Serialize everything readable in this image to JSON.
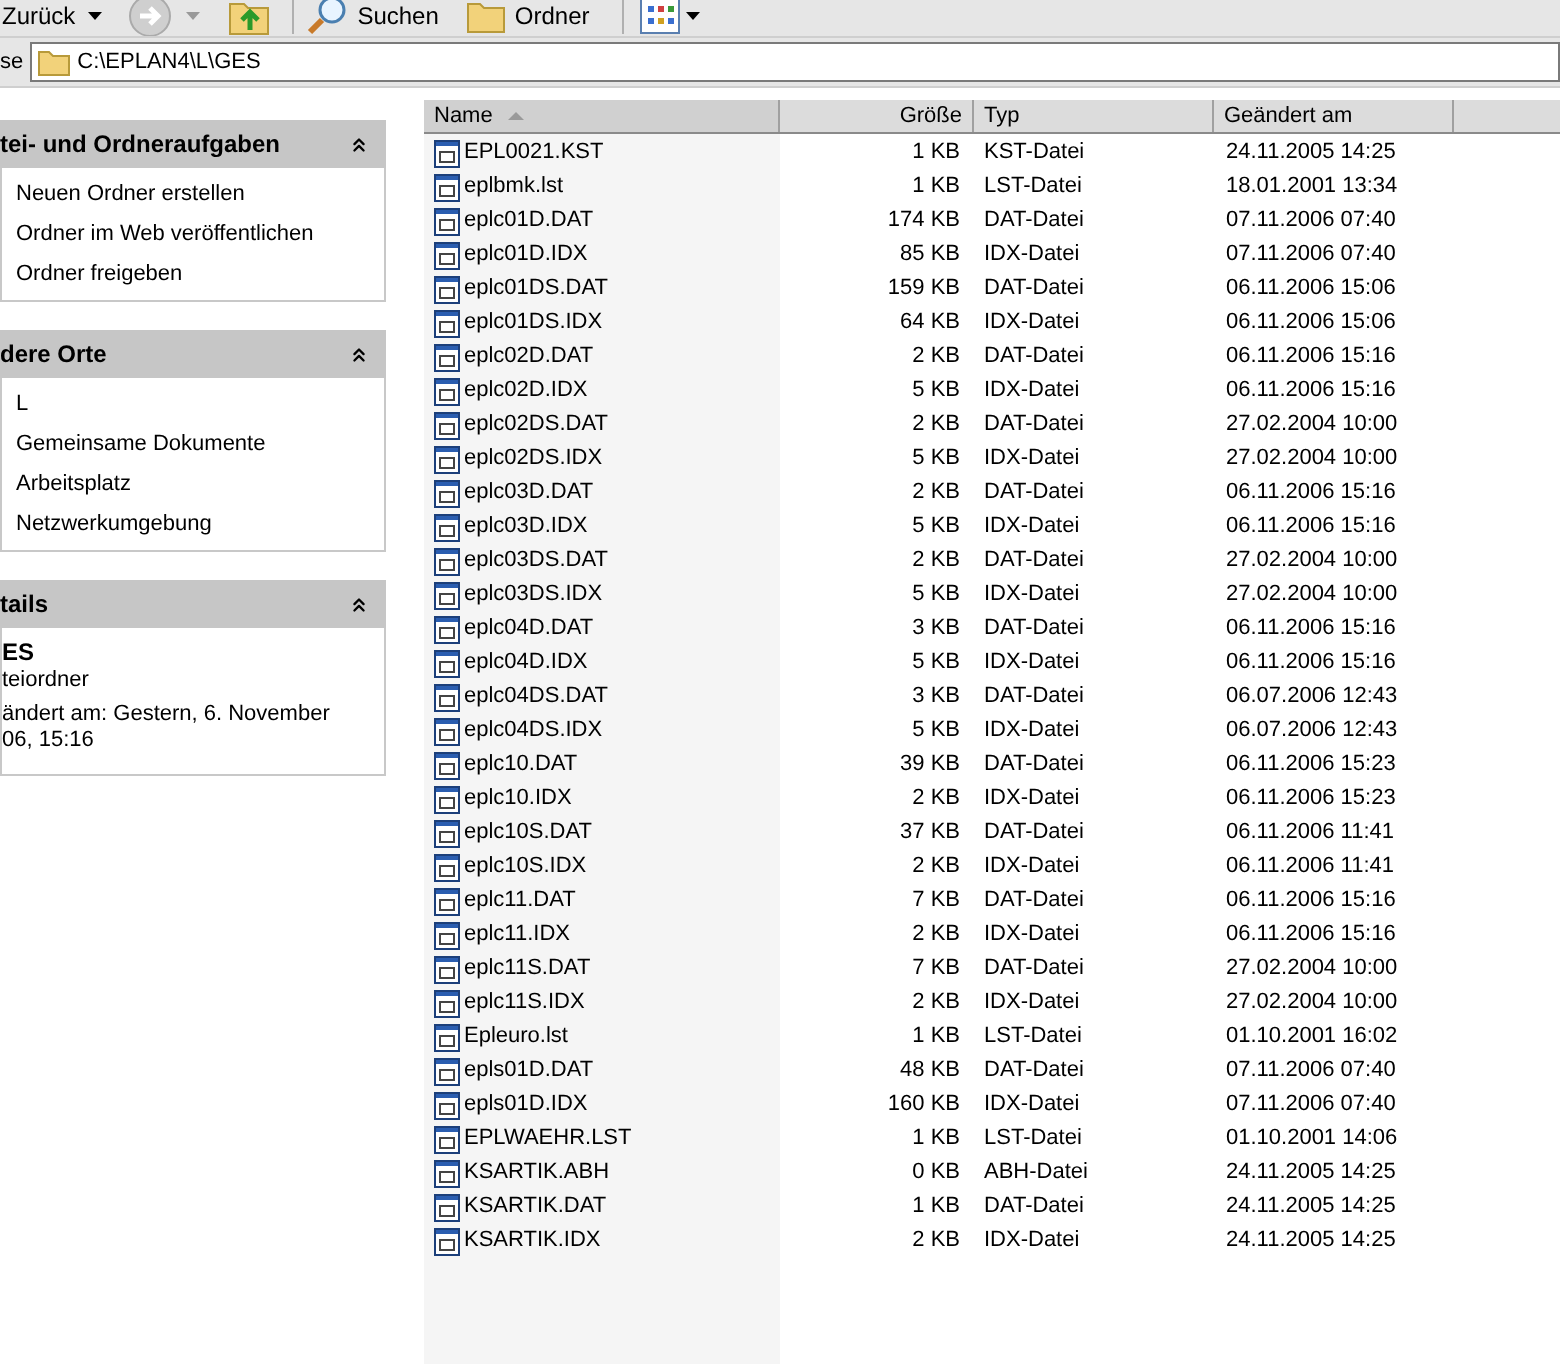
{
  "toolbar": {
    "back": "Zurück",
    "search": "Suchen",
    "folders": "Ordner"
  },
  "address": {
    "label": "se",
    "value": "C:\\EPLAN4\\L\\GES"
  },
  "sidebar": [
    {
      "kind": "links",
      "title": "tei- und Ordneraufgaben",
      "expanded": true,
      "items": [
        "Neuen Ordner erstellen",
        "Ordner im Web veröffentlichen",
        "Ordner freigeben"
      ]
    },
    {
      "kind": "links",
      "title": "dere Orte",
      "expanded": true,
      "items": [
        "L",
        "Gemeinsame Dokumente",
        "Arbeitsplatz",
        "Netzwerkumgebung"
      ]
    },
    {
      "kind": "details",
      "title": "tails",
      "expanded": true,
      "name": "ES",
      "type": "teiordner",
      "modified": [
        "ändert am: Gestern, 6. November",
        "06, 15:16"
      ]
    }
  ],
  "table": {
    "columns": [
      {
        "label": "Name",
        "sorted": true
      },
      {
        "label": "Größe",
        "sorted": false
      },
      {
        "label": "Typ",
        "sorted": false
      },
      {
        "label": "Geändert am",
        "sorted": false
      }
    ],
    "rows": [
      [
        "EPL0021.KST",
        "1 KB",
        "KST-Datei",
        "24.11.2005 14:25"
      ],
      [
        "eplbmk.lst",
        "1 KB",
        "LST-Datei",
        "18.01.2001 13:34"
      ],
      [
        "eplc01D.DAT",
        "174 KB",
        "DAT-Datei",
        "07.11.2006 07:40"
      ],
      [
        "eplc01D.IDX",
        "85 KB",
        "IDX-Datei",
        "07.11.2006 07:40"
      ],
      [
        "eplc01DS.DAT",
        "159 KB",
        "DAT-Datei",
        "06.11.2006 15:06"
      ],
      [
        "eplc01DS.IDX",
        "64 KB",
        "IDX-Datei",
        "06.11.2006 15:06"
      ],
      [
        "eplc02D.DAT",
        "2 KB",
        "DAT-Datei",
        "06.11.2006 15:16"
      ],
      [
        "eplc02D.IDX",
        "5 KB",
        "IDX-Datei",
        "06.11.2006 15:16"
      ],
      [
        "eplc02DS.DAT",
        "2 KB",
        "DAT-Datei",
        "27.02.2004 10:00"
      ],
      [
        "eplc02DS.IDX",
        "5 KB",
        "IDX-Datei",
        "27.02.2004 10:00"
      ],
      [
        "eplc03D.DAT",
        "2 KB",
        "DAT-Datei",
        "06.11.2006 15:16"
      ],
      [
        "eplc03D.IDX",
        "5 KB",
        "IDX-Datei",
        "06.11.2006 15:16"
      ],
      [
        "eplc03DS.DAT",
        "2 KB",
        "DAT-Datei",
        "27.02.2004 10:00"
      ],
      [
        "eplc03DS.IDX",
        "5 KB",
        "IDX-Datei",
        "27.02.2004 10:00"
      ],
      [
        "eplc04D.DAT",
        "3 KB",
        "DAT-Datei",
        "06.11.2006 15:16"
      ],
      [
        "eplc04D.IDX",
        "5 KB",
        "IDX-Datei",
        "06.11.2006 15:16"
      ],
      [
        "eplc04DS.DAT",
        "3 KB",
        "DAT-Datei",
        "06.07.2006 12:43"
      ],
      [
        "eplc04DS.IDX",
        "5 KB",
        "IDX-Datei",
        "06.07.2006 12:43"
      ],
      [
        "eplc10.DAT",
        "39 KB",
        "DAT-Datei",
        "06.11.2006 15:23"
      ],
      [
        "eplc10.IDX",
        "2 KB",
        "IDX-Datei",
        "06.11.2006 15:23"
      ],
      [
        "eplc10S.DAT",
        "37 KB",
        "DAT-Datei",
        "06.11.2006 11:41"
      ],
      [
        "eplc10S.IDX",
        "2 KB",
        "IDX-Datei",
        "06.11.2006 11:41"
      ],
      [
        "eplc11.DAT",
        "7 KB",
        "DAT-Datei",
        "06.11.2006 15:16"
      ],
      [
        "eplc11.IDX",
        "2 KB",
        "IDX-Datei",
        "06.11.2006 15:16"
      ],
      [
        "eplc11S.DAT",
        "7 KB",
        "DAT-Datei",
        "27.02.2004 10:00"
      ],
      [
        "eplc11S.IDX",
        "2 KB",
        "IDX-Datei",
        "27.02.2004 10:00"
      ],
      [
        "Epleuro.lst",
        "1 KB",
        "LST-Datei",
        "01.10.2001 16:02"
      ],
      [
        "epls01D.DAT",
        "48 KB",
        "DAT-Datei",
        "07.11.2006 07:40"
      ],
      [
        "epls01D.IDX",
        "160 KB",
        "IDX-Datei",
        "07.11.2006 07:40"
      ],
      [
        "EPLWAEHR.LST",
        "1 KB",
        "LST-Datei",
        "01.10.2001 14:06"
      ],
      [
        "KSARTIK.ABH",
        "0 KB",
        "ABH-Datei",
        "24.11.2005 14:25"
      ],
      [
        "KSARTIK.DAT",
        "1 KB",
        "DAT-Datei",
        "24.11.2005 14:25"
      ],
      [
        "KSARTIK.IDX",
        "2 KB",
        "IDX-Datei",
        "24.11.2005 14:25"
      ]
    ]
  }
}
